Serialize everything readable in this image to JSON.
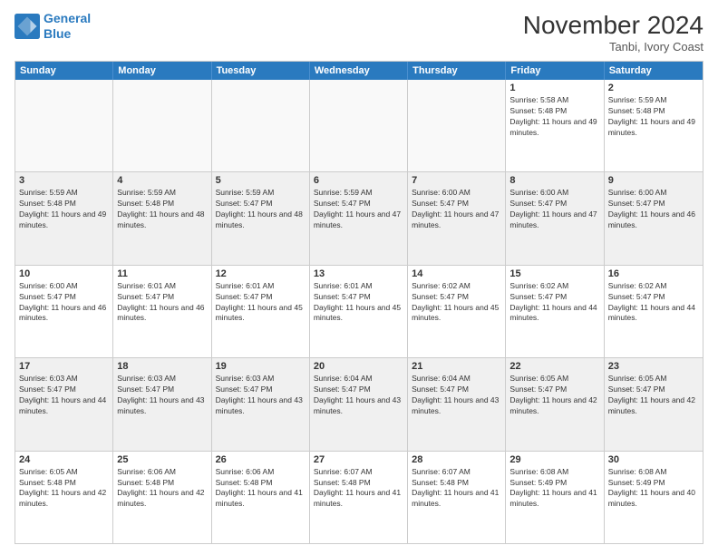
{
  "logo": {
    "line1": "General",
    "line2": "Blue"
  },
  "title": "November 2024",
  "location": "Tanbi, Ivory Coast",
  "header": {
    "days": [
      "Sunday",
      "Monday",
      "Tuesday",
      "Wednesday",
      "Thursday",
      "Friday",
      "Saturday"
    ]
  },
  "rows": [
    {
      "cells": [
        {
          "empty": true
        },
        {
          "empty": true
        },
        {
          "empty": true
        },
        {
          "empty": true
        },
        {
          "empty": true
        },
        {
          "day": 1,
          "sunrise": "5:58 AM",
          "sunset": "5:48 PM",
          "daylight": "11 hours and 49 minutes."
        },
        {
          "day": 2,
          "sunrise": "5:59 AM",
          "sunset": "5:48 PM",
          "daylight": "11 hours and 49 minutes."
        }
      ]
    },
    {
      "cells": [
        {
          "day": 3,
          "sunrise": "5:59 AM",
          "sunset": "5:48 PM",
          "daylight": "11 hours and 49 minutes."
        },
        {
          "day": 4,
          "sunrise": "5:59 AM",
          "sunset": "5:48 PM",
          "daylight": "11 hours and 48 minutes."
        },
        {
          "day": 5,
          "sunrise": "5:59 AM",
          "sunset": "5:47 PM",
          "daylight": "11 hours and 48 minutes."
        },
        {
          "day": 6,
          "sunrise": "5:59 AM",
          "sunset": "5:47 PM",
          "daylight": "11 hours and 47 minutes."
        },
        {
          "day": 7,
          "sunrise": "6:00 AM",
          "sunset": "5:47 PM",
          "daylight": "11 hours and 47 minutes."
        },
        {
          "day": 8,
          "sunrise": "6:00 AM",
          "sunset": "5:47 PM",
          "daylight": "11 hours and 47 minutes."
        },
        {
          "day": 9,
          "sunrise": "6:00 AM",
          "sunset": "5:47 PM",
          "daylight": "11 hours and 46 minutes."
        }
      ]
    },
    {
      "cells": [
        {
          "day": 10,
          "sunrise": "6:00 AM",
          "sunset": "5:47 PM",
          "daylight": "11 hours and 46 minutes."
        },
        {
          "day": 11,
          "sunrise": "6:01 AM",
          "sunset": "5:47 PM",
          "daylight": "11 hours and 46 minutes."
        },
        {
          "day": 12,
          "sunrise": "6:01 AM",
          "sunset": "5:47 PM",
          "daylight": "11 hours and 45 minutes."
        },
        {
          "day": 13,
          "sunrise": "6:01 AM",
          "sunset": "5:47 PM",
          "daylight": "11 hours and 45 minutes."
        },
        {
          "day": 14,
          "sunrise": "6:02 AM",
          "sunset": "5:47 PM",
          "daylight": "11 hours and 45 minutes."
        },
        {
          "day": 15,
          "sunrise": "6:02 AM",
          "sunset": "5:47 PM",
          "daylight": "11 hours and 44 minutes."
        },
        {
          "day": 16,
          "sunrise": "6:02 AM",
          "sunset": "5:47 PM",
          "daylight": "11 hours and 44 minutes."
        }
      ]
    },
    {
      "cells": [
        {
          "day": 17,
          "sunrise": "6:03 AM",
          "sunset": "5:47 PM",
          "daylight": "11 hours and 44 minutes."
        },
        {
          "day": 18,
          "sunrise": "6:03 AM",
          "sunset": "5:47 PM",
          "daylight": "11 hours and 43 minutes."
        },
        {
          "day": 19,
          "sunrise": "6:03 AM",
          "sunset": "5:47 PM",
          "daylight": "11 hours and 43 minutes."
        },
        {
          "day": 20,
          "sunrise": "6:04 AM",
          "sunset": "5:47 PM",
          "daylight": "11 hours and 43 minutes."
        },
        {
          "day": 21,
          "sunrise": "6:04 AM",
          "sunset": "5:47 PM",
          "daylight": "11 hours and 43 minutes."
        },
        {
          "day": 22,
          "sunrise": "6:05 AM",
          "sunset": "5:47 PM",
          "daylight": "11 hours and 42 minutes."
        },
        {
          "day": 23,
          "sunrise": "6:05 AM",
          "sunset": "5:47 PM",
          "daylight": "11 hours and 42 minutes."
        }
      ]
    },
    {
      "cells": [
        {
          "day": 24,
          "sunrise": "6:05 AM",
          "sunset": "5:48 PM",
          "daylight": "11 hours and 42 minutes."
        },
        {
          "day": 25,
          "sunrise": "6:06 AM",
          "sunset": "5:48 PM",
          "daylight": "11 hours and 42 minutes."
        },
        {
          "day": 26,
          "sunrise": "6:06 AM",
          "sunset": "5:48 PM",
          "daylight": "11 hours and 41 minutes."
        },
        {
          "day": 27,
          "sunrise": "6:07 AM",
          "sunset": "5:48 PM",
          "daylight": "11 hours and 41 minutes."
        },
        {
          "day": 28,
          "sunrise": "6:07 AM",
          "sunset": "5:48 PM",
          "daylight": "11 hours and 41 minutes."
        },
        {
          "day": 29,
          "sunrise": "6:08 AM",
          "sunset": "5:49 PM",
          "daylight": "11 hours and 41 minutes."
        },
        {
          "day": 30,
          "sunrise": "6:08 AM",
          "sunset": "5:49 PM",
          "daylight": "11 hours and 40 minutes."
        }
      ]
    }
  ]
}
